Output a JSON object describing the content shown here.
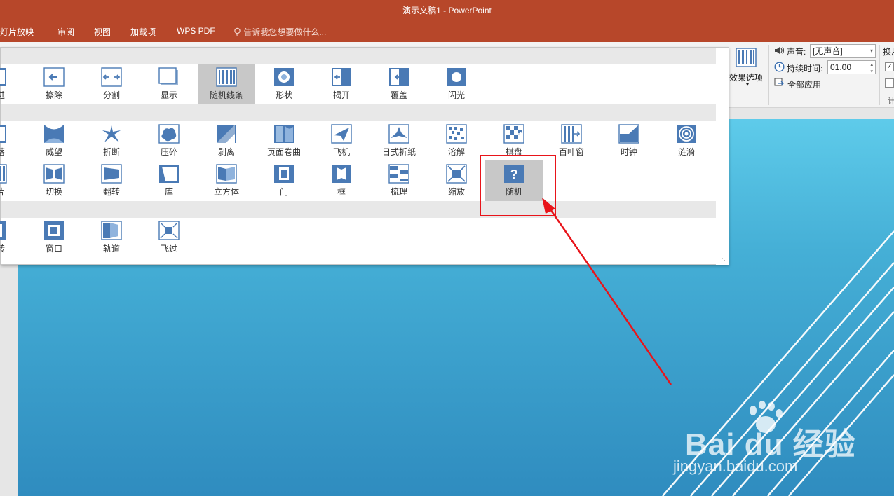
{
  "window": {
    "title": "演示文稿1 - PowerPoint"
  },
  "menu": {
    "items": [
      "幻灯片放映",
      "审阅",
      "视图",
      "加载项",
      "WPS PDF"
    ],
    "tell_me": "告诉我您想要做什么..."
  },
  "ribbon": {
    "effect_options_label": "效果选项",
    "sound_label": "声音:",
    "sound_value": "[无声音]",
    "duration_label": "持续时间:",
    "duration_value": "01.00",
    "apply_all_label": "全部应用",
    "next_group_label": "换片",
    "timing_group_label": "计"
  },
  "gallery": {
    "row1": [
      {
        "label": "推进",
        "icon": "push-icon"
      },
      {
        "label": "擦除",
        "icon": "wipe-icon"
      },
      {
        "label": "分割",
        "icon": "split-icon"
      },
      {
        "label": "显示",
        "icon": "reveal-icon"
      },
      {
        "label": "随机线条",
        "icon": "random-bars-icon",
        "selected": true
      },
      {
        "label": "形状",
        "icon": "shape-icon"
      },
      {
        "label": "揭开",
        "icon": "uncover-icon"
      },
      {
        "label": "覆盖",
        "icon": "cover-icon"
      },
      {
        "label": "闪光",
        "icon": "flash-icon"
      }
    ],
    "row2": [
      {
        "label": "跌落",
        "icon": "fall-icon"
      },
      {
        "label": "威望",
        "icon": "prestige-icon"
      },
      {
        "label": "折断",
        "icon": "fracture-icon"
      },
      {
        "label": "压碎",
        "icon": "crush-icon"
      },
      {
        "label": "剥离",
        "icon": "peel-icon"
      },
      {
        "label": "页面卷曲",
        "icon": "page-curl-icon"
      },
      {
        "label": "飞机",
        "icon": "airplane-icon"
      },
      {
        "label": "日式折纸",
        "icon": "origami-icon"
      },
      {
        "label": "溶解",
        "icon": "dissolve-icon"
      },
      {
        "label": "棋盘",
        "icon": "checkerboard-icon"
      },
      {
        "label": "百叶窗",
        "icon": "blinds-icon"
      },
      {
        "label": "时钟",
        "icon": "clock-icon"
      },
      {
        "label": "涟漪",
        "icon": "ripple-icon"
      }
    ],
    "row3": [
      {
        "label": "碎片",
        "icon": "shred-icon"
      },
      {
        "label": "切换",
        "icon": "switch-icon"
      },
      {
        "label": "翻转",
        "icon": "flip-icon"
      },
      {
        "label": "库",
        "icon": "gallery-icon"
      },
      {
        "label": "立方体",
        "icon": "cube-icon"
      },
      {
        "label": "门",
        "icon": "doors-icon"
      },
      {
        "label": "框",
        "icon": "box-icon"
      },
      {
        "label": "梳理",
        "icon": "comb-icon"
      },
      {
        "label": "缩放",
        "icon": "zoom-icon"
      },
      {
        "label": "随机",
        "icon": "random-icon",
        "highlighted": true
      }
    ],
    "row4": [
      {
        "label": "旋转",
        "icon": "rotate-icon"
      },
      {
        "label": "窗口",
        "icon": "window-icon"
      },
      {
        "label": "轨道",
        "icon": "orbit-icon"
      },
      {
        "label": "飞过",
        "icon": "fly-through-icon"
      }
    ]
  },
  "watermark": {
    "logo": "Bai du 经验",
    "url": "jingyan.baidu.com"
  },
  "colors": {
    "title_bar": "#b7472a",
    "accent_red": "#e8141a",
    "icon_blue": "#4a7ab5"
  }
}
